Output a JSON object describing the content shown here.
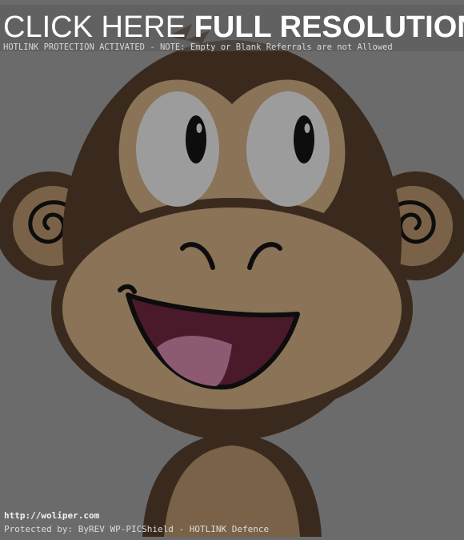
{
  "banner": {
    "headline_thin": "CLICK HERE ",
    "headline_bold": "FULL RESOLUTION",
    "notice": "HOTLINK PROTECTION ACTIVATED - NOTE: Empty or Blank Referrals are not Allowed"
  },
  "footer": {
    "url": "http://woliper.com",
    "protection": "Protected by: ByREV WP-PICShield - HOTLINK Defence"
  },
  "artwork": {
    "subject": "monkey-face-illustration",
    "colors": {
      "background": "#6b6b6b",
      "fur": "#3a2a1e",
      "face": "#8a7356",
      "eye_white": "#9c9c9c",
      "pupil": "#0d0d0d",
      "mouth": "#4a1a2a",
      "tongue": "#8e5a72"
    }
  }
}
